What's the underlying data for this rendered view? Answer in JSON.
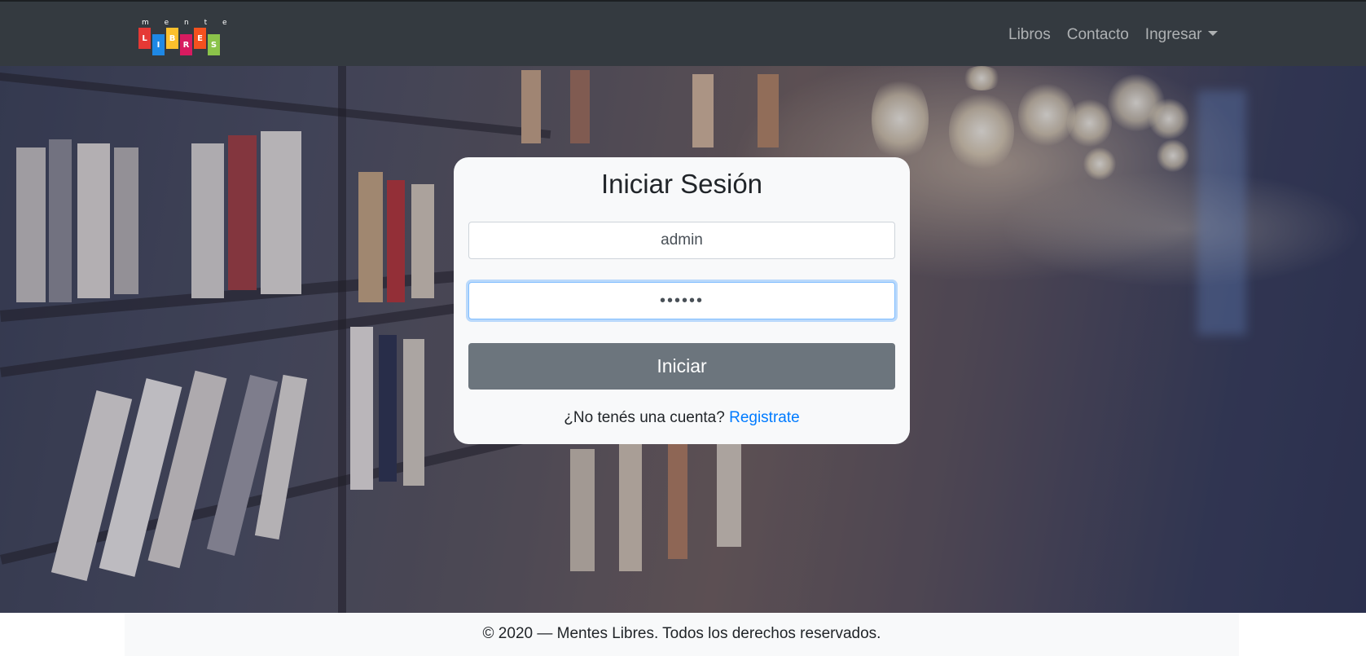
{
  "brand": {
    "logo_top": "m e n t e s",
    "logo_letters": [
      {
        "letter": "L",
        "color": "#e53935"
      },
      {
        "letter": "I",
        "color": "#1e88e5"
      },
      {
        "letter": "B",
        "color": "#fbc02d"
      },
      {
        "letter": "R",
        "color": "#d81b60"
      },
      {
        "letter": "E",
        "color": "#f4511e"
      },
      {
        "letter": "S",
        "color": "#8bc34a"
      }
    ]
  },
  "nav": {
    "libros": "Libros",
    "contacto": "Contacto",
    "ingresar": "Ingresar"
  },
  "login": {
    "title": "Iniciar Sesión",
    "username_value": "admin",
    "password_value": "••••••",
    "submit_label": "Iniciar",
    "signup_prompt": "¿No tenés una cuenta? ",
    "signup_link": "Registrate"
  },
  "footer": {
    "text": "© 2020 — Mentes Libres. Todos los derechos reservados."
  },
  "colors": {
    "navbar": "#343a40",
    "button": "#6c757d",
    "link": "#007bff",
    "focus": "#80bdff"
  },
  "icons": {
    "dropdown": "caret-down-icon"
  }
}
